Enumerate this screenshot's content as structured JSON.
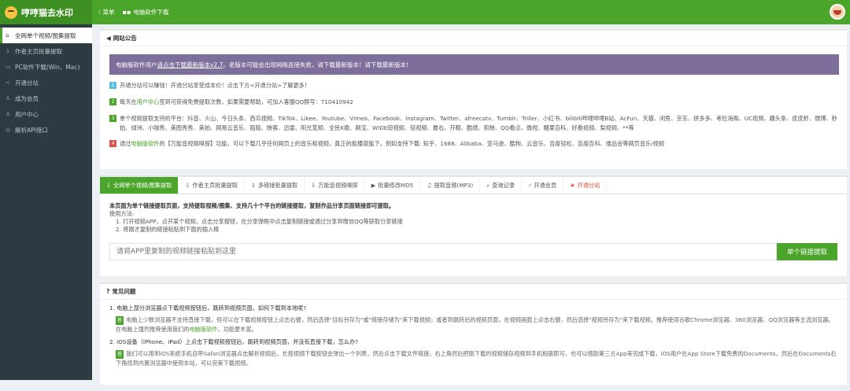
{
  "app": {
    "title": "哼哼猫去水印"
  },
  "topnav": [
    {
      "icon": "⁝",
      "label": "菜单"
    },
    {
      "icon": "",
      "label": "电脑软件下载"
    }
  ],
  "sidebar": {
    "items": [
      {
        "icon": "⌂",
        "label": "全网单个视频/图集提取"
      },
      {
        "icon": "⇩",
        "label": "作者主页批量提取"
      },
      {
        "icon": "▭",
        "label": "PC软件下载(Win、Mac)"
      },
      {
        "icon": "≺",
        "label": "开通分站"
      },
      {
        "icon": "♙",
        "label": "成为会员"
      },
      {
        "icon": "♙",
        "label": "用户中心"
      },
      {
        "icon": "◎",
        "label": "解析API接口"
      }
    ]
  },
  "notice": {
    "title": "网站公告",
    "bar_prefix": "电脑版软件用户",
    "bar_link": "请点击下载最新版本v2.7",
    "bar_suffix": "。老版本可能会出现网络连接失败，请下载最新版本！请下载最新版本！",
    "items": [
      {
        "num": "1",
        "text": "开通分站可以赚钱！开通分站享受成本价！点击下方<开通分站>了解更多！"
      },
      {
        "num": "2",
        "pre": "每天在",
        "link": "用户中心",
        "post": "签到可获得免费提取次数，如果需要帮助，可加入客服QQ群号：710410942"
      },
      {
        "num": "3",
        "text": "单个视频提取支持的平台：抖音、火山、今日头条、西瓜视频、TikTok、Likee、Youtube、Vimeo、Facebook、Instagram、Twitter、afreecatv、Tumblr、Triller、小红书、bilibili哔哩哔哩B站、AcFun、天猫、闲鱼、京东、拼多多、考拉海购、UC视频、趣头条、皮皮虾、微博、秒拍、绿洲、小咖秀、美图秀秀、美拍、网易云音乐、陌陌、映客、迅雷、阳光宽频、全民K歌、刷宝、WIDE短视频、轻视频、最右、开眼、酷燃、剪映、QQ看点、微视、糖果百科、好看视频、梨视频、**等"
      },
      {
        "num": "4",
        "pre": "通过",
        "link": "电脑版软件",
        "post": "的【万能音视频嗅探】功能，可以下载几乎任何网页上的音乐和视频，真正的能播就能下。例如支持下载: 知乎、1688、Alibaba、亚马逊、酷狗、云音乐、百度轻松、百度百科、维品会等网页音乐/视频"
      }
    ]
  },
  "tabs": [
    {
      "icon": "⇩",
      "label": "全网单个视频/图集提取"
    },
    {
      "icon": "⇩",
      "label": "作者主页批量提取"
    },
    {
      "icon": "⇩",
      "label": "多链接批量提取"
    },
    {
      "icon": "⇩",
      "label": "万能音视频嗅探"
    },
    {
      "icon": "▶",
      "label": "批量修改MD5"
    },
    {
      "icon": "♫",
      "label": "提取音频(MP3)"
    },
    {
      "icon": "⌕",
      "label": "查询记录"
    },
    {
      "icon": "☝",
      "label": "开通会员"
    },
    {
      "icon": "★",
      "label": "开通分站"
    }
  ],
  "extract": {
    "headline": "本页面为单个链接提取页面，支持提取视频/图集、支持几十个平台的链接提取，复制作品分享页面链接即可提取。",
    "usage_label": "使用方法:",
    "step1": "1. 打开视频APP，点开某个视频，点击分享按钮，在分享弹框中点击复制链接或通过分享到微信QQ等获取分享链接",
    "step2": "2. 将刚才复制的链接粘贴到下面的输入框",
    "placeholder": "请将APP里复制的视频链接粘贴到这里",
    "button": "单个链接提取"
  },
  "faq": {
    "title": "常见问题",
    "answer_tag": "答",
    "q1": "1. 电脑上部分浏览器点下载视频按钮后，跳转到视频页面，如何下载到本地呢?",
    "a1_pre": "电脑上少数浏览器不支持直接下载，但可以在下载视频按钮上点击右键，然后选择\"目标另存为\"或\"链接存储为\"来下载视频；或者到跳转后的视频页面，在视频画面上点击右键，然后选择\"视频另存为\"来下载视频。推荐使用谷歌Chrome浏览器、360浏览器、QQ浏览器等主流浏览器。在电脑上强烈推荐使用我们的",
    "a1_link": "电脑版软件",
    "a1_post": "，功能更丰富。",
    "q2": "2. iOS设备（iPhone、iPad）上点击下载视频按钮后，跳转到视频页面，并没有直接下载，怎么办?",
    "a2": "我们可以用到iOS系统手机自带Safari浏览器点击解析视频后，长按视频下载按钮会弹出一个列表，然后点击下载文件链接，右上角然后把刚下载的视频储存视频到手机相册即可，也可以借助第三方App来完成下载，iOS用户在App Store下载免费的Documents，然后在Documents右下角找到内置浏览器中使用本站，可以完美下载视频。"
  }
}
